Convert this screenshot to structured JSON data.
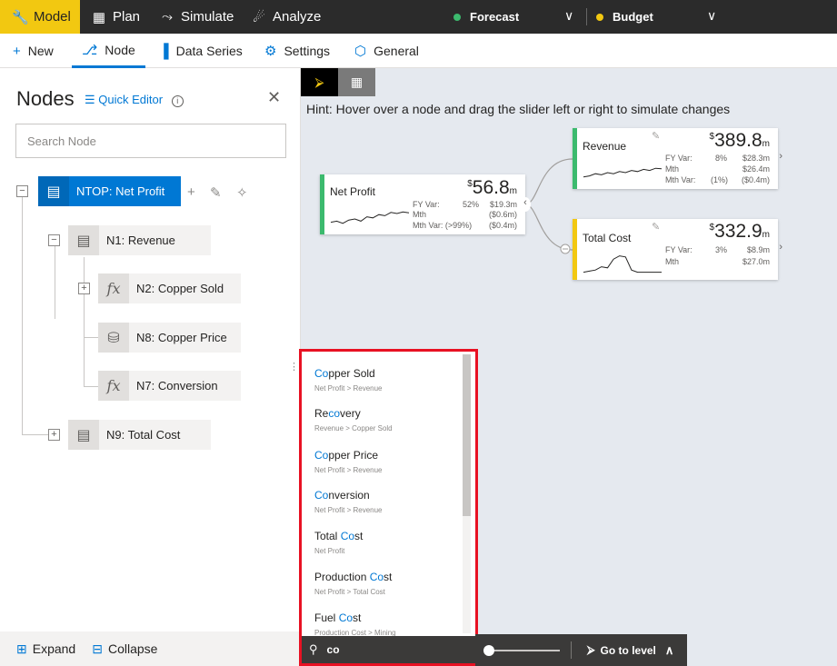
{
  "colors": {
    "accent": "#0078d4",
    "nav_active": "#f2c811",
    "forecast": "#3cba6e",
    "budget": "#f2c811",
    "positive": "#3cba6e",
    "warning": "#f2c811",
    "highlight_border": "#e81123"
  },
  "topnav": {
    "items": [
      {
        "label": "Model",
        "icon": "wrench-icon"
      },
      {
        "label": "Plan",
        "icon": "table-icon"
      },
      {
        "label": "Simulate",
        "icon": "simulate-icon"
      },
      {
        "label": "Analyze",
        "icon": "telescope-icon"
      }
    ],
    "scenarios": [
      {
        "label": "Forecast"
      },
      {
        "label": "Budget"
      }
    ]
  },
  "ribbon": {
    "items": [
      {
        "label": "New",
        "icon": "plus-icon"
      },
      {
        "label": "Node",
        "icon": "node-icon"
      },
      {
        "label": "Data Series",
        "icon": "bar-chart-icon"
      },
      {
        "label": "Settings",
        "icon": "gear-icon"
      },
      {
        "label": "General",
        "icon": "cube-icon"
      }
    ]
  },
  "nodes_panel": {
    "title": "Nodes",
    "quick_editor": "Quick Editor",
    "search_placeholder": "Search Node",
    "tree": [
      {
        "label": "NTOP: Net Profit",
        "icon": "calculator-icon",
        "selected": true
      },
      {
        "label": "N1: Revenue",
        "icon": "calculator-icon"
      },
      {
        "label": "N2: Copper Sold",
        "icon": "function-icon"
      },
      {
        "label": "N8: Copper Price",
        "icon": "database-icon"
      },
      {
        "label": "N7: Conversion",
        "icon": "function-icon"
      },
      {
        "label": "N9: Total Cost",
        "icon": "calculator-icon"
      }
    ],
    "fx": "fx",
    "footer": {
      "expand": "Expand",
      "collapse": "Collapse"
    }
  },
  "canvas": {
    "hint": "Hint: Hover over a node and drag the slider left or right to simulate changes",
    "cards": [
      {
        "name": "Net Profit",
        "currency": "$",
        "value": "56.8",
        "unit": "m",
        "color": "#3cba6e",
        "rows": [
          {
            "k": "FY Var:",
            "p": "52%",
            "v": "$19.3m"
          },
          {
            "k": "Mth",
            "p": "",
            "v": "($0.6m)"
          },
          {
            "k": "Mth Var: (>99%)",
            "p": "",
            "v": "($0.4m)"
          }
        ],
        "spark": [
          0.35,
          0.4,
          0.3,
          0.45,
          0.5,
          0.4,
          0.6,
          0.55,
          0.7,
          0.65,
          0.8,
          0.75,
          0.82,
          0.78
        ]
      },
      {
        "name": "Revenue",
        "currency": "$",
        "value": "389.8",
        "unit": "m",
        "color": "#3cba6e",
        "rows": [
          {
            "k": "FY Var:",
            "p": "8%",
            "v": "$28.3m"
          },
          {
            "k": "Mth",
            "p": "",
            "v": "$26.4m"
          },
          {
            "k": "Mth Var:",
            "p": "(1%)",
            "v": "($0.4m)"
          }
        ],
        "spark": [
          0.3,
          0.35,
          0.45,
          0.4,
          0.5,
          0.45,
          0.55,
          0.5,
          0.6,
          0.55,
          0.65,
          0.6,
          0.7,
          0.68
        ]
      },
      {
        "name": "Total Cost",
        "currency": "$",
        "value": "332.9",
        "unit": "m",
        "color": "#f2c811",
        "rows": [
          {
            "k": "FY Var:",
            "p": "3%",
            "v": "$8.9m"
          },
          {
            "k": "Mth",
            "p": "",
            "v": "$27.0m"
          }
        ],
        "spark": [
          0.1,
          0.15,
          0.2,
          0.35,
          0.3,
          0.7,
          0.85,
          0.8,
          0.2,
          0.1,
          0.1,
          0.1,
          0.1,
          0.1
        ]
      }
    ]
  },
  "search_popup": {
    "query": "co",
    "results": [
      {
        "pre": "",
        "match": "Co",
        "post": "pper Sold",
        "path": "Net Profit > Revenue"
      },
      {
        "pre": "Re",
        "match": "co",
        "post": "very",
        "path": "Revenue > Copper Sold"
      },
      {
        "pre": "",
        "match": "Co",
        "post": "pper Price",
        "path": "Net Profit > Revenue"
      },
      {
        "pre": "",
        "match": "Co",
        "post": "nversion",
        "path": "Net Profit > Revenue"
      },
      {
        "pre": "Total ",
        "match": "Co",
        "post": "st",
        "path": "Net Profit"
      },
      {
        "pre": "Production ",
        "match": "Co",
        "post": "st",
        "path": "Net Profit > Total Cost"
      },
      {
        "pre": "Fuel ",
        "match": "Co",
        "post": "st",
        "path": "Production Cost > Mining"
      }
    ]
  },
  "bottom_toolbar": {
    "go_to_level": "Go to level"
  }
}
